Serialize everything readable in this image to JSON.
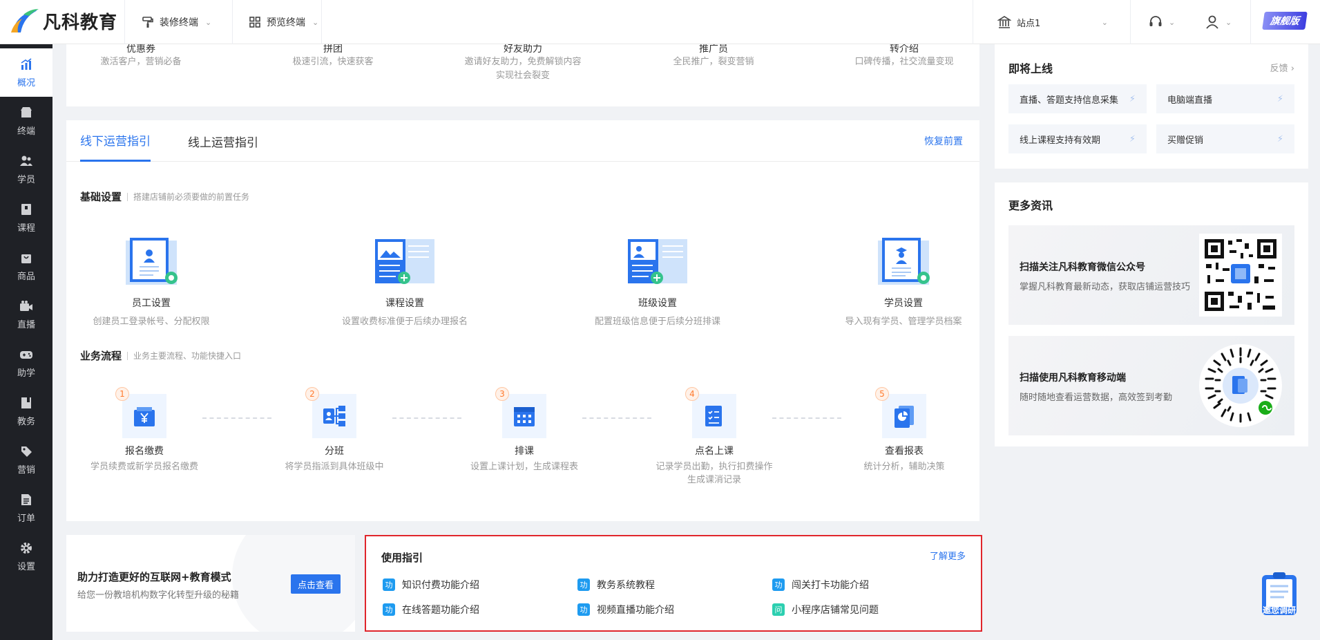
{
  "header": {
    "logo_text": "凡科教育",
    "menu_decorate": "装修终端",
    "menu_preview": "预览终端",
    "site": "站点1",
    "vip_badge": "旗舰版"
  },
  "sidebar": {
    "items": [
      {
        "label": "概况",
        "icon": "chart-icon",
        "active": true
      },
      {
        "label": "终端",
        "icon": "store-icon"
      },
      {
        "label": "学员",
        "icon": "users-icon"
      },
      {
        "label": "课程",
        "icon": "book-icon"
      },
      {
        "label": "商品",
        "icon": "bag-icon"
      },
      {
        "label": "直播",
        "icon": "video-icon"
      },
      {
        "label": "助学",
        "icon": "gamepad-icon"
      },
      {
        "label": "教务",
        "icon": "notebook-icon"
      },
      {
        "label": "营销",
        "icon": "tag-icon"
      },
      {
        "label": "订单",
        "icon": "document-icon"
      },
      {
        "label": "设置",
        "icon": "gear-icon"
      }
    ]
  },
  "promotions": [
    {
      "title": "优惠券",
      "desc": "激活客户，营销必备",
      "desc2": ""
    },
    {
      "title": "拼团",
      "desc": "极速引流，快速获客",
      "desc2": ""
    },
    {
      "title": "好友助力",
      "desc": "邀请好友助力，免费解锁内容",
      "desc2": "实现社会裂变"
    },
    {
      "title": "推广员",
      "desc": "全民推广，裂变营销",
      "desc2": ""
    },
    {
      "title": "转介绍",
      "desc": "口碑传播，社交流量变现",
      "desc2": ""
    }
  ],
  "guide": {
    "tab_offline": "线下运营指引",
    "tab_online": "线上运营指引",
    "restore": "恢复前置",
    "basic_title": "基础设置",
    "basic_sub": "搭建店铺前必须要做的前置任务",
    "settings": [
      {
        "title": "员工设置",
        "desc": "创建员工登录帐号、分配权限"
      },
      {
        "title": "课程设置",
        "desc": "设置收费标准便于后续办理报名"
      },
      {
        "title": "班级设置",
        "desc": "配置班级信息便于后续分班排课"
      },
      {
        "title": "学员设置",
        "desc": "导入现有学员、管理学员档案"
      }
    ],
    "flow_title": "业务流程",
    "flow_sub": "业务主要流程、功能快捷入口",
    "flows": [
      {
        "num": "1",
        "title": "报名缴费",
        "desc": "学员续费或新学员报名缴费",
        "desc2": ""
      },
      {
        "num": "2",
        "title": "分班",
        "desc": "将学员指派到具体班级中",
        "desc2": ""
      },
      {
        "num": "3",
        "title": "排课",
        "desc": "设置上课计划，生成课程表",
        "desc2": ""
      },
      {
        "num": "4",
        "title": "点名上课",
        "desc": "记录学员出勤，执行扣费操作",
        "desc2": "生成课消记录"
      },
      {
        "num": "5",
        "title": "查看报表",
        "desc": "统计分析，辅助决策",
        "desc2": ""
      }
    ]
  },
  "banner": {
    "title": "助力打造更好的互联网+教育模式",
    "desc": "给您一份教培机构数字化转型升级的秘籍",
    "button": "点击查看"
  },
  "usage": {
    "title": "使用指引",
    "more": "了解更多",
    "items": [
      {
        "tag": "功",
        "label": "知识付费功能介绍",
        "color": "#1e9bf0"
      },
      {
        "tag": "功",
        "label": "教务系统教程",
        "color": "#1e9bf0"
      },
      {
        "tag": "功",
        "label": "闯关打卡功能介绍",
        "color": "#1e9bf0"
      },
      {
        "tag": "功",
        "label": "在线答题功能介绍",
        "color": "#1e9bf0"
      },
      {
        "tag": "功",
        "label": "视频直播功能介绍",
        "color": "#1e9bf0"
      },
      {
        "tag": "问",
        "label": "小程序店铺常见问题",
        "color": "#2ccfb0"
      }
    ]
  },
  "upcoming": {
    "title": "即将上线",
    "feedback": "反馈",
    "items": [
      "直播、答题支持信息采集",
      "电脑端直播",
      "线上课程支持有效期",
      "买赠促销"
    ]
  },
  "news": {
    "title": "更多资讯",
    "items": [
      {
        "title": "扫描关注凡科教育微信公众号",
        "desc": "掌握凡科教育最新动态，获取店铺运营技巧"
      },
      {
        "title": "扫描使用凡科教育移动端",
        "desc": "随时随地查看运营数据，高效签到考勤"
      }
    ]
  },
  "float_button": "邀您调研",
  "colors": {
    "accent": "#2a74ed",
    "sidebar_bg": "#1f2126",
    "highlight_border": "#e0252b"
  }
}
